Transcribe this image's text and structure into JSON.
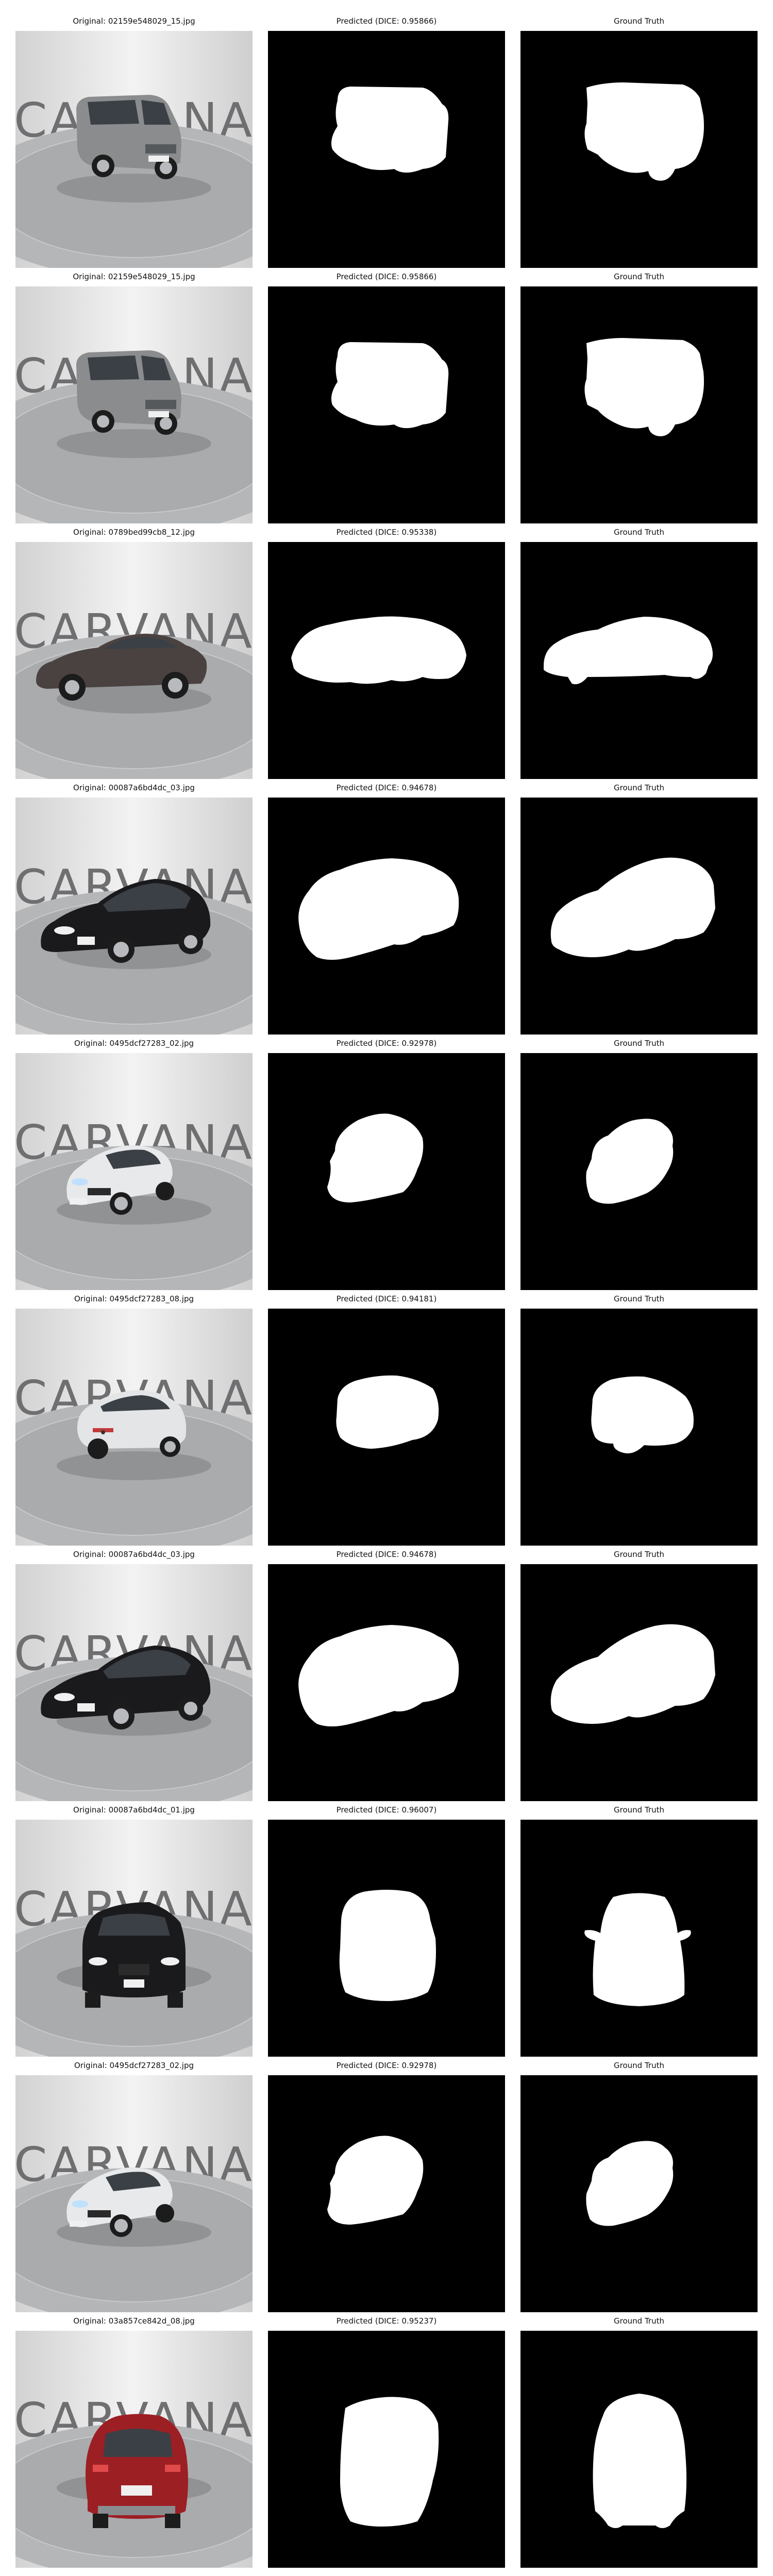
{
  "figure": {
    "rows": [
      {
        "original_title": "Original: 02159e548029_15.jpg",
        "predicted_title": "Predicted (DICE: 0.95866)",
        "truth_title": "Ground Truth",
        "wordmark": "CARVANA",
        "car": {
          "kind": "boxy",
          "view": "front-left",
          "color": "#8a8c8e"
        },
        "pred_mask": "boxy-pred",
        "truth_mask": "boxy-truth"
      },
      {
        "original_title": "Original: 02159e548029_15.jpg",
        "predicted_title": "Predicted (DICE: 0.95866)",
        "truth_title": "Ground Truth",
        "wordmark": "CARVANA",
        "car": {
          "kind": "boxy",
          "view": "front-left",
          "color": "#8a8c8e"
        },
        "pred_mask": "boxy-pred",
        "truth_mask": "boxy-truth"
      },
      {
        "original_title": "Original: 0789bed99cb8_12.jpg",
        "predicted_title": "Predicted (DICE: 0.95338)",
        "truth_title": "Ground Truth",
        "wordmark": "CARVANA",
        "car": {
          "kind": "sedan",
          "view": "side-left",
          "color": "#4a4240"
        },
        "pred_mask": "side-pred",
        "truth_mask": "side-truth"
      },
      {
        "original_title": "Original: 00087a6bd4dc_03.jpg",
        "predicted_title": "Predicted (DICE: 0.94678)",
        "truth_title": "Ground Truth",
        "wordmark": "CARVANA",
        "car": {
          "kind": "sedan",
          "view": "front-left",
          "color": "#1a1a1c"
        },
        "pred_mask": "sedan34-pred",
        "truth_mask": "sedan34-truth"
      },
      {
        "original_title": "Original: 0495dcf27283_02.jpg",
        "predicted_title": "Predicted (DICE: 0.92978)",
        "truth_title": "Ground Truth",
        "wordmark": "CARVANA",
        "car": {
          "kind": "coupe",
          "view": "front-left",
          "color": "#e8e9ea"
        },
        "pred_mask": "coupe-front-pred",
        "truth_mask": "coupe-front-truth"
      },
      {
        "original_title": "Original: 0495dcf27283_08.jpg",
        "predicted_title": "Predicted (DICE: 0.94181)",
        "truth_title": "Ground Truth",
        "wordmark": "CARVANA",
        "car": {
          "kind": "coupe",
          "view": "rear-left",
          "color": "#e4e5e7"
        },
        "pred_mask": "coupe-rear-pred",
        "truth_mask": "coupe-rear-truth"
      },
      {
        "original_title": "Original: 00087a6bd4dc_03.jpg",
        "predicted_title": "Predicted (DICE: 0.94678)",
        "truth_title": "Ground Truth",
        "wordmark": "CARVANA",
        "car": {
          "kind": "sedan",
          "view": "front-left",
          "color": "#1a1a1c"
        },
        "pred_mask": "sedan34-pred",
        "truth_mask": "sedan34-truth"
      },
      {
        "original_title": "Original: 00087a6bd4dc_01.jpg",
        "predicted_title": "Predicted (DICE: 0.96007)",
        "truth_title": "Ground Truth",
        "wordmark": "CARVANA",
        "car": {
          "kind": "sedan",
          "view": "front",
          "color": "#1a1a1c"
        },
        "pred_mask": "front-pred",
        "truth_mask": "front-truth"
      },
      {
        "original_title": "Original: 0495dcf27283_02.jpg",
        "predicted_title": "Predicted (DICE: 0.92978)",
        "truth_title": "Ground Truth",
        "wordmark": "CARVANA",
        "car": {
          "kind": "coupe",
          "view": "front-left",
          "color": "#e8e9ea"
        },
        "pred_mask": "coupe-front-pred",
        "truth_mask": "coupe-front-truth"
      },
      {
        "original_title": "Original: 03a857ce842d_08.jpg",
        "predicted_title": "Predicted (DICE: 0.95237)",
        "truth_title": "Ground Truth",
        "wordmark": "CARVANA",
        "car": {
          "kind": "suv",
          "view": "rear",
          "color": "#9c1f24"
        },
        "pred_mask": "suv-rear-pred",
        "truth_mask": "suv-rear-truth"
      }
    ]
  },
  "colors": {
    "background": "#ffffff",
    "mask_background": "#000000",
    "mask_foreground": "#ffffff",
    "wordmark": "#6f6f72",
    "studio_wall": "#dcdcdc",
    "turntable": "#a9abad"
  }
}
